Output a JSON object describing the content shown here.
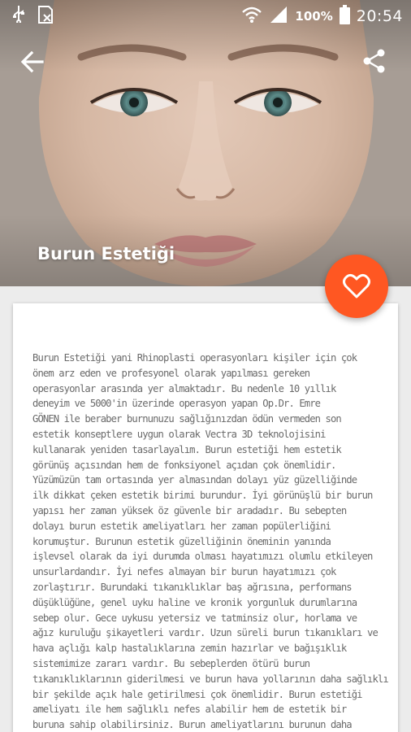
{
  "status_bar": {
    "icons": [
      "usb-icon",
      "sim-icon",
      "wifi-icon",
      "signal-icon",
      "battery-icon"
    ],
    "battery_percent": "100%",
    "time": "20:54"
  },
  "app_bar": {
    "back_icon": "arrow-back-icon",
    "share_icon": "share-icon"
  },
  "hero": {
    "title": "Burun Estetiği"
  },
  "fab": {
    "icon": "heart-outline-icon",
    "color": "#ff5722"
  },
  "article": {
    "lines": [
      "Burun Estetiği yani Rhinoplasti operasyonları kişiler için çok",
      "önem arz eden ve profesyonel olarak yapılması gereken",
      "operasyonlar arasında yer almaktadır. Bu nedenle 10 yıllık",
      "deneyim ve 5000'in üzerinde operasyon yapan Op.Dr. Emre",
      "GÖNEN ile beraber burnunuzu sağlığınızdan ödün vermeden son",
      "estetik konseptlere uygun olarak Vectra 3D teknolojisini",
      "kullanarak yeniden tasarlayalım. Burun estetiği hem estetik",
      "görünüş açısından hem de fonksiyonel açıdan çok önemlidir.",
      "Yüzümüzün tam ortasında yer almasından dolayı yüz güzelliğinde",
      "ilk dikkat çeken estetik birimi burundur. İyi görünüşlü bir burun",
      "yapısı her zaman yüksek öz güvenle bir aradadır. Bu sebepten",
      "dolayı burun estetik ameliyatları her zaman popülerliğini",
      "korumuştur. Burunun estetik güzelliğinin öneminin yanında",
      "işlevsel olarak da iyi durumda olması hayatımızı olumlu etkileyen",
      "unsurlardandır. İyi nefes almayan bir burun hayatımızı çok",
      "zorlaştırır. Burundaki tıkanıklıklar baş ağrısına, performans",
      "düşüklüğüne, genel uyku haline ve kronik yorgunluk durumlarına",
      "sebep olur. Gece uykusu yetersiz ve tatminsiz olur, horlama ve",
      "ağız kuruluğu şikayetleri vardır. Uzun süreli burun tıkanıkları ve",
      "hava açlığı kalp hastalıklarına zemin hazırlar ve bağışıklık",
      "sistemimize zararı vardır. Bu sebeplerden ötürü burun",
      "tıkanıklıklarının giderilmesi ve burun hava yollarının daha sağlıklı",
      "bir şekilde açık hale getirilmesi çok önemlidir. Burun estetiği",
      "ameliyatı ile hem sağlıklı nefes alabilir hem de estetik bir",
      "buruna sahip olabilirsiniz. Burun ameliyatlarını burunun daha"
    ]
  }
}
